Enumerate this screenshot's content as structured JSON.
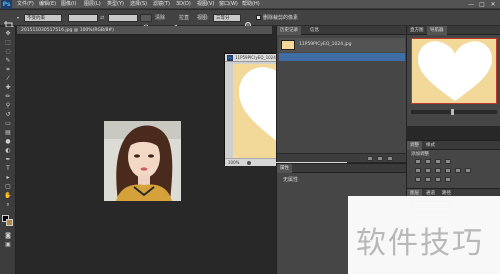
{
  "app": {
    "logo": "Ps"
  },
  "menubar": {
    "items": [
      "文件(F)",
      "编辑(E)",
      "图像(I)",
      "图层(L)",
      "类型(Y)",
      "选择(S)",
      "滤镜(T)",
      "3D(D)",
      "视图(V)",
      "窗口(W)",
      "帮助(H)"
    ],
    "window_buttons": [
      "—",
      "□",
      "✕"
    ]
  },
  "optbar": {
    "style_value": "不受约束",
    "swap_glyph": "⇄",
    "clear_label": "清除",
    "straighten_label": "拉直",
    "view_label": "视图:",
    "view_value": "三等分",
    "delete_cropped_label": "删除裁剪的像素"
  },
  "document": {
    "tab_label": "201511030517516.jpg @ 100%(RGB/8#)"
  },
  "floating_window": {
    "title": "11P59PIC(yEQ_1024.jpg @ 100%(RGB/8#)",
    "zoom": "100%"
  },
  "history_panel": {
    "tabs": [
      "历史记录",
      "信息"
    ],
    "snapshot_label": "11P59PICyEQ_1024.jpg"
  },
  "properties_panel": {
    "tab": "属性",
    "label": "无属性"
  },
  "navigator_panel": {
    "tabs": [
      "直方图",
      "导航器"
    ]
  },
  "adjustments_panel": {
    "tabs": [
      "调整",
      "样式"
    ],
    "label": "添加调整"
  },
  "layers_panel": {
    "tabs": [
      "图层",
      "通道",
      "路径"
    ]
  },
  "watermark": {
    "text": "软件技巧"
  }
}
